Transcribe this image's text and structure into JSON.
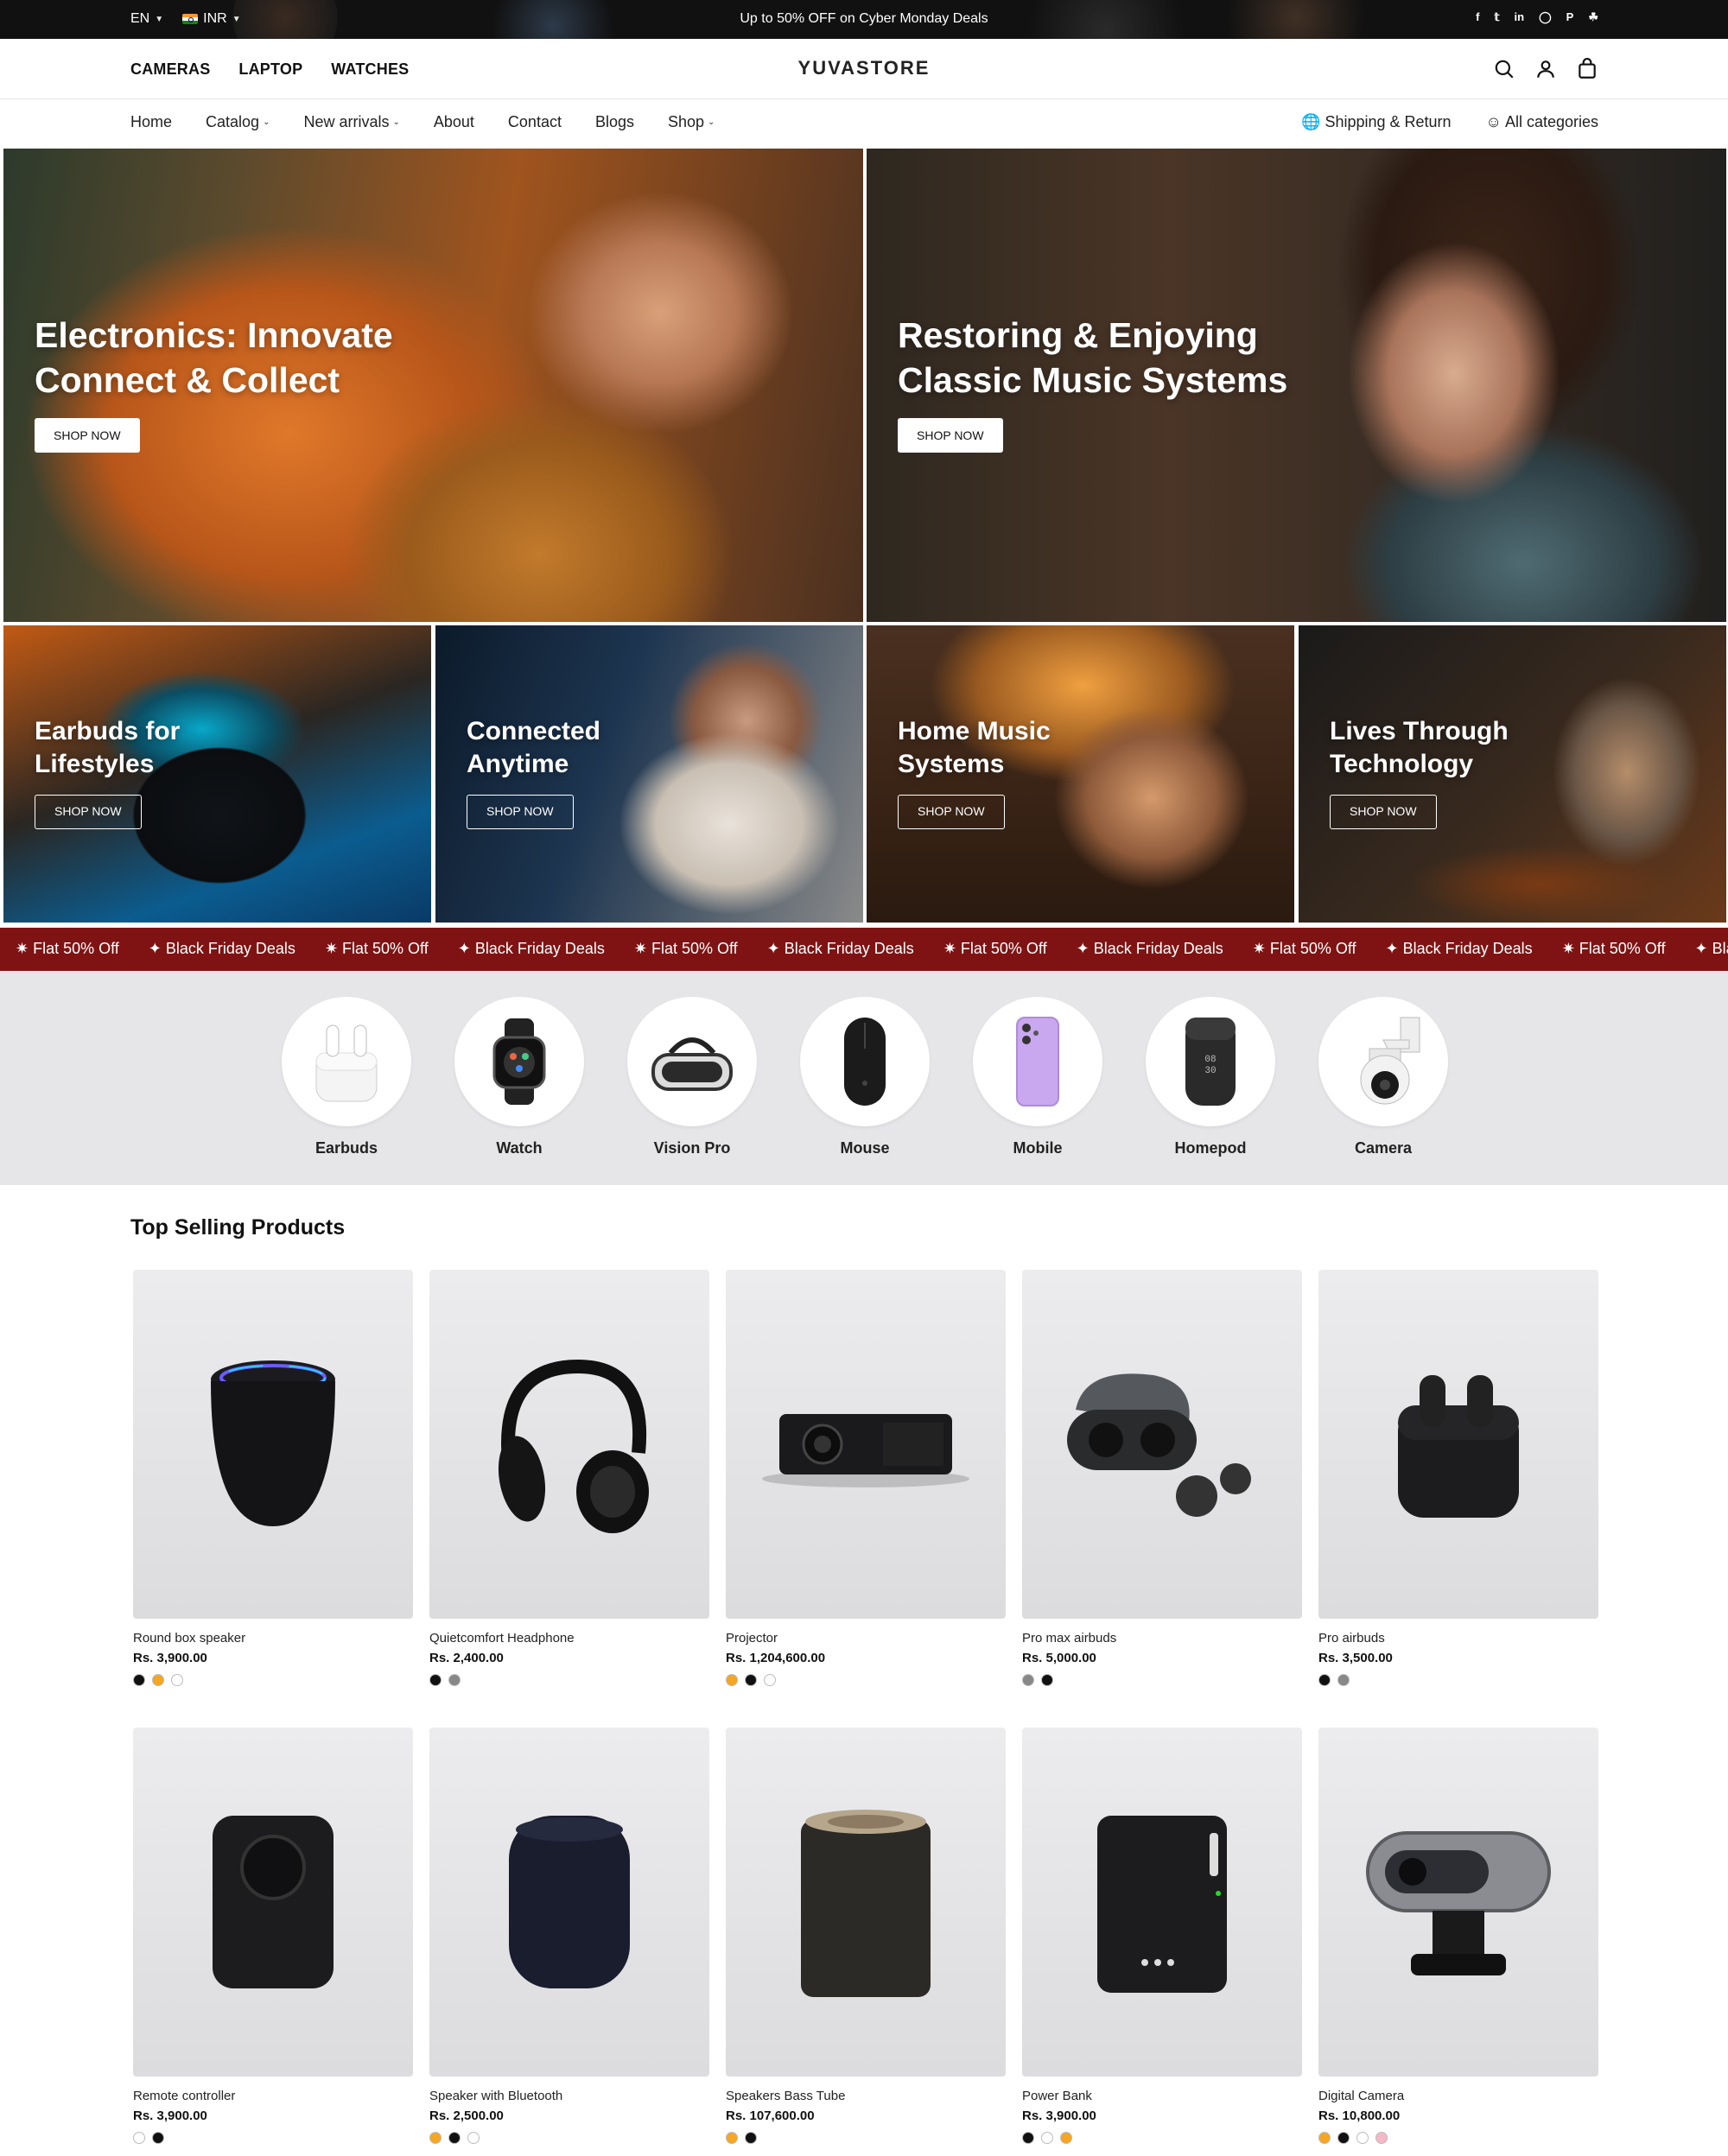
{
  "topbar": {
    "language": "EN",
    "currency": "INR",
    "promo": "Up to 50% OFF on Cyber Monday Deals",
    "social": [
      "facebook-icon",
      "twitter-icon",
      "linkedin-icon",
      "instagram-icon",
      "pinterest-icon",
      "snapchat-icon"
    ]
  },
  "header": {
    "categories": [
      "CAMERAS",
      "LAPTOP",
      "WATCHES"
    ],
    "logo": "YUVASTORE"
  },
  "nav": {
    "items": [
      "Home",
      "Catalog",
      "New arrivals",
      "About",
      "Contact",
      "Blogs",
      "Shop"
    ],
    "dropdown_items": [
      "Catalog",
      "New arrivals",
      "Shop"
    ],
    "shipping": "Shipping & Return",
    "all_categories": "All categories"
  },
  "banners": [
    {
      "title_line1": "Electronics: Innovate",
      "title_line2": "Connect & Collect",
      "button": "SHOP NOW"
    },
    {
      "title_line1": "Restoring & Enjoying",
      "title_line2": "Classic Music Systems",
      "button": "SHOP NOW"
    },
    {
      "title_line1": "Earbuds for",
      "title_line2": "Lifestyles",
      "button": "SHOP NOW"
    },
    {
      "title_line1": "Connected",
      "title_line2": "Anytime",
      "button": "SHOP NOW"
    },
    {
      "title_line1": "Home Music",
      "title_line2": "Systems",
      "button": "SHOP NOW"
    },
    {
      "title_line1": "Lives Through",
      "title_line2": "Technology",
      "button": "SHOP NOW"
    }
  ],
  "marquee": [
    "✷ Flat 50% Off",
    "✦ Black Friday Deals",
    "✷ Flat 50% Off",
    "✦ Black Friday Deals",
    "✷ Flat 50% Off",
    "✦ Black Friday Deals",
    "✷ Flat 50% Off",
    "✦ Black Friday Deals",
    "✷ Flat 50% Off",
    "✦ Black Friday Deals",
    "✷ Flat 50% Off",
    "✦ Black Friday Deals"
  ],
  "categories": [
    "Earbuds",
    "Watch",
    "Vision Pro",
    "Mouse",
    "Mobile",
    "Homepod",
    "Camera"
  ],
  "top_selling": {
    "title": "Top Selling Products",
    "products": [
      {
        "name": "Round box speaker",
        "price": "Rs. 3,900.00",
        "swatches": [
          "#111111",
          "#f5a623",
          "#ffffff"
        ]
      },
      {
        "name": "Quietcomfort Headphone",
        "price": "Rs. 2,400.00",
        "swatches": [
          "#111111",
          "#888888"
        ]
      },
      {
        "name": "Projector",
        "price": "Rs. 1,204,600.00",
        "swatches": [
          "#f5a623",
          "#111111",
          "#ffffff"
        ]
      },
      {
        "name": "Pro max airbuds",
        "price": "Rs. 5,000.00",
        "swatches": [
          "#888888",
          "#111111"
        ]
      },
      {
        "name": "Pro airbuds",
        "price": "Rs. 3,500.00",
        "swatches": [
          "#111111",
          "#888888"
        ]
      },
      {
        "name": "Remote controller",
        "price": "Rs. 3,900.00",
        "swatches": [
          "#ffffff",
          "#111111"
        ]
      },
      {
        "name": "Speaker with Bluetooth",
        "price": "Rs. 2,500.00",
        "swatches": [
          "#f5a623",
          "#111111",
          "#ffffff"
        ]
      },
      {
        "name": "Speakers Bass Tube",
        "price": "Rs. 107,600.00",
        "swatches": [
          "#f5a623",
          "#111111"
        ]
      },
      {
        "name": "Power Bank",
        "price": "Rs. 3,900.00",
        "swatches": [
          "#111111",
          "#ffffff",
          "#f5a623"
        ]
      },
      {
        "name": "Digital Camera",
        "price": "Rs. 10,800.00",
        "swatches": [
          "#f5a623",
          "#111111",
          "#ffffff",
          "#f6b8c8"
        ]
      }
    ]
  },
  "colors": {
    "marquee_bg": "#7f1313",
    "topbar_bg": "#111111",
    "category_strip_bg": "#e6e6e9"
  }
}
